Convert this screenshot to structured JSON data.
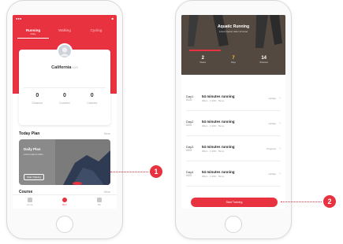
{
  "colors": {
    "accent": "#e8323f",
    "highlight": "#f3c03a"
  },
  "phone1": {
    "status": {
      "left": "●●●",
      "right": "■"
    },
    "tabs": [
      {
        "label": "Running",
        "sub": "Daily"
      },
      {
        "label": "Walking",
        "sub": ""
      },
      {
        "label": "Cycling",
        "sub": ""
      }
    ],
    "profile": {
      "name": "California",
      "badge": "LV2"
    },
    "stats": [
      {
        "value": "0",
        "label": "Distance"
      },
      {
        "value": "0",
        "label": "Duration"
      },
      {
        "value": "0",
        "label": "Calories"
      }
    ],
    "today_plan": {
      "title": "Today Plan",
      "more": "More",
      "card_title": "Daily Plan",
      "card_sub": "Lorem ipsum dolor",
      "card_button": "Start Training"
    },
    "course": {
      "title": "Course",
      "more": "More"
    },
    "bottom_tabs": [
      {
        "icon": "home-icon",
        "label": "Home"
      },
      {
        "icon": "run-icon",
        "label": "Run"
      },
      {
        "icon": "profile-icon",
        "label": "Me"
      }
    ]
  },
  "phone2": {
    "hero": {
      "title": "Aquatic Running",
      "sub": "Lorem ipsum dolor sit amet",
      "stats": [
        {
          "value": "2",
          "label": "Weeks"
        },
        {
          "value": "7",
          "label": "Days"
        },
        {
          "value": "14",
          "label": "Workouts"
        }
      ]
    },
    "rows": [
      {
        "day": "Day1",
        "num": "01/3",
        "title": "54 minutes running",
        "meta": "30km · 1:30/h · 6kms",
        "status": "Update"
      },
      {
        "day": "Day2",
        "num": "02/3",
        "title": "54 minutes running",
        "meta": "30km · 1:30/h · 6kms",
        "status": "Update"
      },
      {
        "day": "Day3",
        "num": "03/3",
        "title": "54 minutes running",
        "meta": "30km · 1:30/h · 6kms",
        "status": "Progress"
      },
      {
        "day": "Day4",
        "num": "04/3",
        "title": "54 minutes running",
        "meta": "30km · 1:30/h · 6kms",
        "status": "Update"
      }
    ],
    "cta": "Start Training"
  },
  "callouts": [
    "1",
    "2"
  ]
}
